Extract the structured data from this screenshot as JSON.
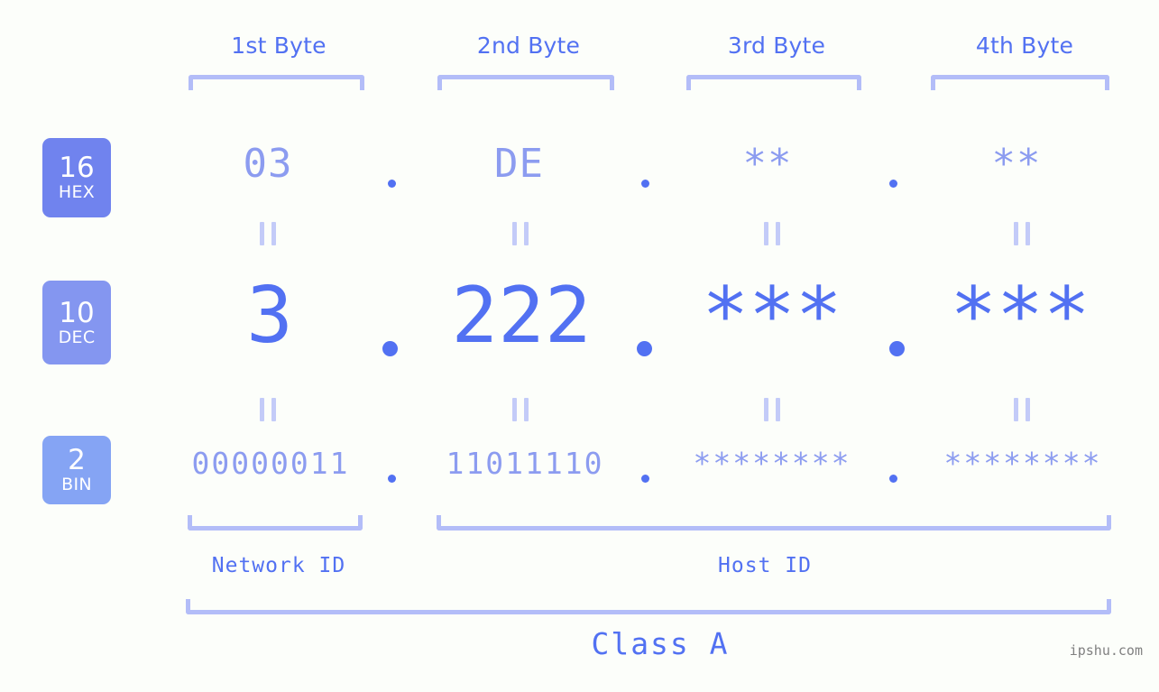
{
  "headers": [
    {
      "label": "1st Byte"
    },
    {
      "label": "2nd Byte"
    },
    {
      "label": "3rd Byte"
    },
    {
      "label": "4th Byte"
    }
  ],
  "rows": {
    "hex": {
      "badge_number": "16",
      "badge_abbr": "HEX",
      "bytes": [
        "03",
        "DE",
        "**",
        "**"
      ],
      "separator": "."
    },
    "dec": {
      "badge_number": "10",
      "badge_abbr": "DEC",
      "bytes": [
        "3",
        "222",
        "***",
        "***"
      ],
      "separator": "."
    },
    "bin": {
      "badge_number": "2",
      "badge_abbr": "BIN",
      "bytes": [
        "00000011",
        "11011110",
        "********",
        "********"
      ],
      "separator": "."
    }
  },
  "equals_marker": "=",
  "sections": {
    "network_id": "Network ID",
    "host_id": "Host ID",
    "class": "Class A"
  },
  "watermark": "ipshu.com",
  "colors": {
    "background": "#FCFEFA",
    "accent_strong": "#5271F2",
    "accent_soft": "#8C9CF0",
    "bracket": "#B3BDF8",
    "badge_hex": "#7083EE",
    "badge_dec": "#8496F0",
    "badge_bin": "#85A4F4",
    "watermark": "#808080"
  }
}
